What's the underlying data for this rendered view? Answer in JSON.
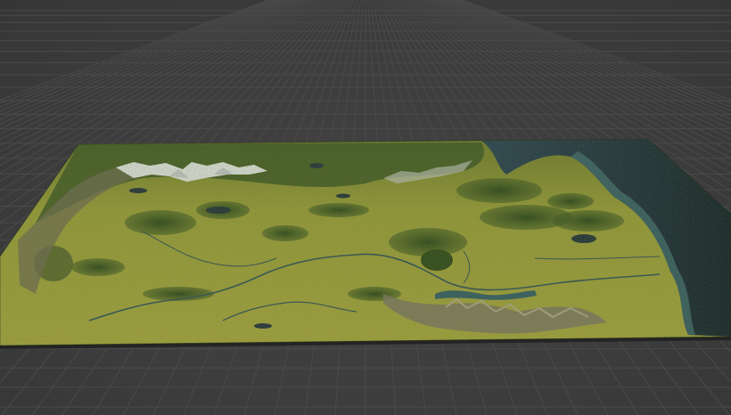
{
  "scene": {
    "view": "3d-perspective",
    "background_color": "#3d3d3d",
    "grid_color": "#4a4a4a",
    "object": "terrain-heightmap",
    "terrain_colors": {
      "grassland": "#a8a43c",
      "forest": "#2f4a1e",
      "snow": "#e6e9ec",
      "rock": "#8a8276",
      "water": "#20344a",
      "deep_ocean": "#0f1d30",
      "shallow_water": "#3d6e7a"
    }
  }
}
